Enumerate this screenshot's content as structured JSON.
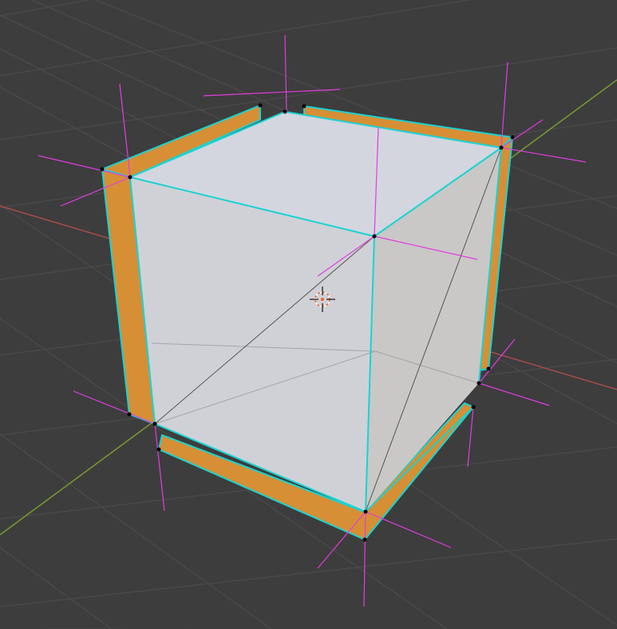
{
  "viewport": {
    "background_color": "#3d3d3d",
    "grid_color": "#4c4c4c",
    "x_axis_color": "#b04a4a",
    "y_axis_color": "#7a9a36"
  },
  "mesh": {
    "object_type": "cube",
    "mode": "edit",
    "face_color": "#d3d6dd",
    "side_face_color": "#c7c7c7",
    "extruded_face_color": "#d68f35",
    "selected_edge_color": "#19d3d3",
    "normal_line_color": "#e23ce2",
    "vertex_color": "#000000"
  },
  "origin_marker": {
    "icon": "crosshair-icon",
    "color": "#e86b2a"
  }
}
